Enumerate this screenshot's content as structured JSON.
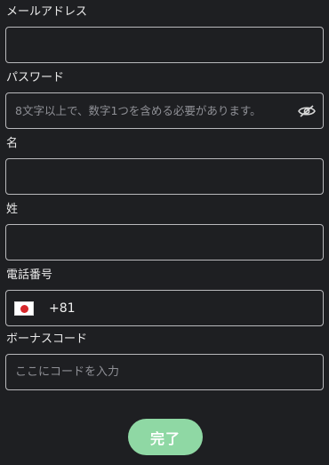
{
  "email": {
    "label": "メールアドレス",
    "value": "",
    "placeholder": ""
  },
  "password": {
    "label": "パスワード",
    "value": "",
    "placeholder": "8文字以上で、数字1つを含める必要があります。",
    "toggle_icon": "eye-off-icon"
  },
  "first_name": {
    "label": "名",
    "value": "",
    "placeholder": ""
  },
  "last_name": {
    "label": "姓",
    "value": "",
    "placeholder": ""
  },
  "phone": {
    "label": "電話番号",
    "country_flag": "japan-flag-icon",
    "dial_code": "+81",
    "value": ""
  },
  "bonus_code": {
    "label": "ボーナスコード",
    "value": "",
    "placeholder": "ここにコードを入力"
  },
  "submit": {
    "label": "完了"
  },
  "colors": {
    "background": "#1e1f22",
    "field_border": "#b9b9bc",
    "accent": "#8fd8a4",
    "flag_red": "#d7282c"
  }
}
